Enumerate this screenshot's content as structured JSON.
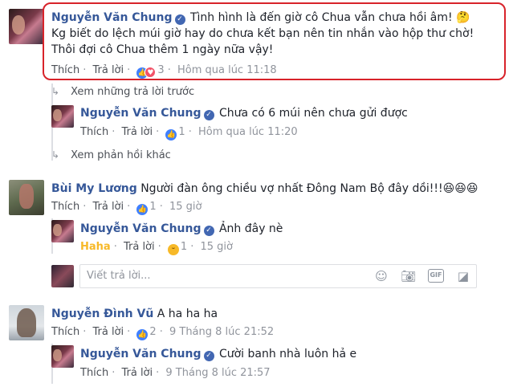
{
  "comment1": {
    "author": "Nguyễn Văn Chung",
    "line1": "Tình hình là đến giờ cô Chua vẫn chưa hồi âm! 🤔",
    "line2": "Kg biết do lệch múi giờ hay do chưa kết bạn nên tin nhắn vào hộp thư chờ!",
    "line3": "Thôi đợi cô Chua thêm 1 ngày nữa vậy!",
    "like": "Thích",
    "reply": "Trả lời",
    "reactions": "3",
    "time": "Hôm qua lúc 11:18",
    "highlight_color": "#d8232a"
  },
  "prev_replies": "Xem những trả lời trước",
  "reply1": {
    "author": "Nguyễn Văn Chung",
    "text": "Chưa có 6 múi nên chưa gửi được",
    "like": "Thích",
    "reply": "Trả lời",
    "reactions": "1",
    "time": "Hôm qua lúc 11:20"
  },
  "more_replies": "Xem phản hồi khác",
  "comment2": {
    "author": "Bùi My Lương",
    "text": "Người đàn ông chiều vợ nhất Đông Nam Bộ đây dồi!!!😆😆😆",
    "like": "Thích",
    "reply": "Trả lời",
    "reactions": "1",
    "time": "15 giờ"
  },
  "reply2": {
    "author": "Nguyễn Văn Chung",
    "text": "Ảnh đây nè",
    "like": "Haha",
    "reply": "Trả lời",
    "reactions": "1",
    "time": "15 giờ"
  },
  "write_reply": {
    "placeholder": "Viết trả lời..."
  },
  "comment3": {
    "author": "Nguyễn Đình Vũ",
    "text": "A ha ha ha",
    "like": "Thích",
    "reply": "Trả lời",
    "reactions": "2",
    "time": "9 Tháng 8 lúc 21:52"
  },
  "reply3": {
    "author": "Nguyễn Văn Chung",
    "text": "Cười banh nhà luôn hả e",
    "like": "Thích",
    "reply": "Trả lời",
    "time": "9 Tháng 8 lúc 21:57"
  },
  "icons": {
    "verified": "verified-badge-icon",
    "like_reaction": "like-reaction-icon",
    "love_reaction": "love-reaction-icon",
    "haha_reaction": "haha-reaction-icon",
    "reply_arrow": "reply-arrow-icon",
    "emoji": "emoji-icon",
    "camera": "camera-icon",
    "gif": "gif-icon",
    "sticker": "sticker-icon"
  },
  "accent_color": "#365899"
}
